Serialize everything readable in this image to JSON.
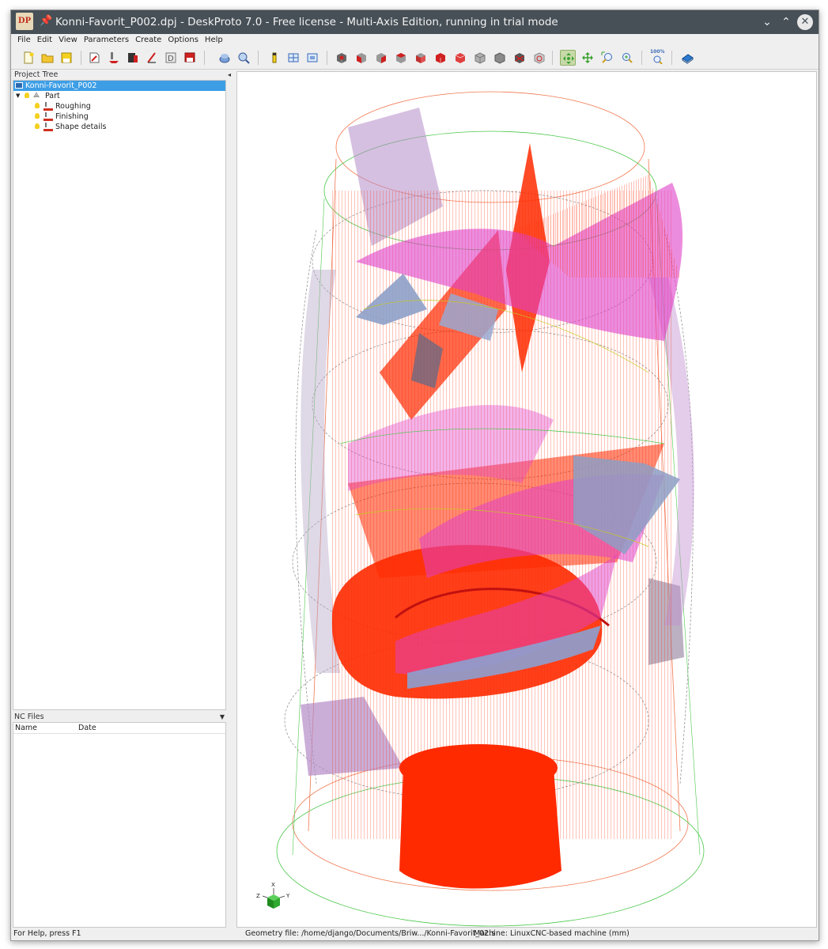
{
  "window": {
    "title": "Konni-Favorit_P002.dpj - DeskProto 7.0 - Free license - Multi-Axis Edition, running in trial mode",
    "logo_text": "DP",
    "controls": {
      "minimize": "⌄",
      "maximize": "⌃",
      "close": "✕"
    }
  },
  "menu": [
    "File",
    "Edit",
    "View",
    "Parameters",
    "Create",
    "Options",
    "Help"
  ],
  "toolbar": {
    "icons": [
      "new-project",
      "open-project",
      "save-project",
      "part-parameters",
      "operation",
      "layer",
      "vector",
      "bitmap",
      "export",
      "simulate",
      "preview",
      "info",
      "grid",
      "screen",
      "view-iso",
      "view-front",
      "view-right",
      "view-back",
      "view-left",
      "view-top",
      "view-bottom",
      "view-solid",
      "view-wire",
      "view-toolpath",
      "view-stock",
      "rotate",
      "pan",
      "zoom-window",
      "zoom-in",
      "zoom-100",
      "help-book"
    ],
    "zoom_label": "100%"
  },
  "project_tree": {
    "header": "Project Tree",
    "items": [
      {
        "label": "Konni-Favorit_P002",
        "level": 0,
        "selected": true
      },
      {
        "label": "Part",
        "level": 1,
        "selected": false
      },
      {
        "label": "Roughing",
        "level": 2,
        "selected": false
      },
      {
        "label": "Finishing",
        "level": 2,
        "selected": false
      },
      {
        "label": "Shape details",
        "level": 2,
        "selected": false
      }
    ]
  },
  "nc_files": {
    "header": "NC Files",
    "columns": [
      "Name",
      "Date"
    ]
  },
  "viewport": {
    "axis_labels": {
      "x": "X",
      "y": "Y",
      "z": "Z"
    }
  },
  "status": {
    "help": "For Help, press F1",
    "geometry": "Geometry file: /home/django/Documents/Briw.../Konni-Favorit_02.s",
    "machine": "Machine: LinuxCNC-based machine (mm)"
  },
  "colors": {
    "titlebar": "#475057",
    "selection": "#3d9ee6",
    "toolpath": "#ff2a00",
    "part_magenta": "#e040c8",
    "part_lilac": "#b48cc8",
    "stock_green": "#4bc84b",
    "stock_orange": "#f07850"
  }
}
